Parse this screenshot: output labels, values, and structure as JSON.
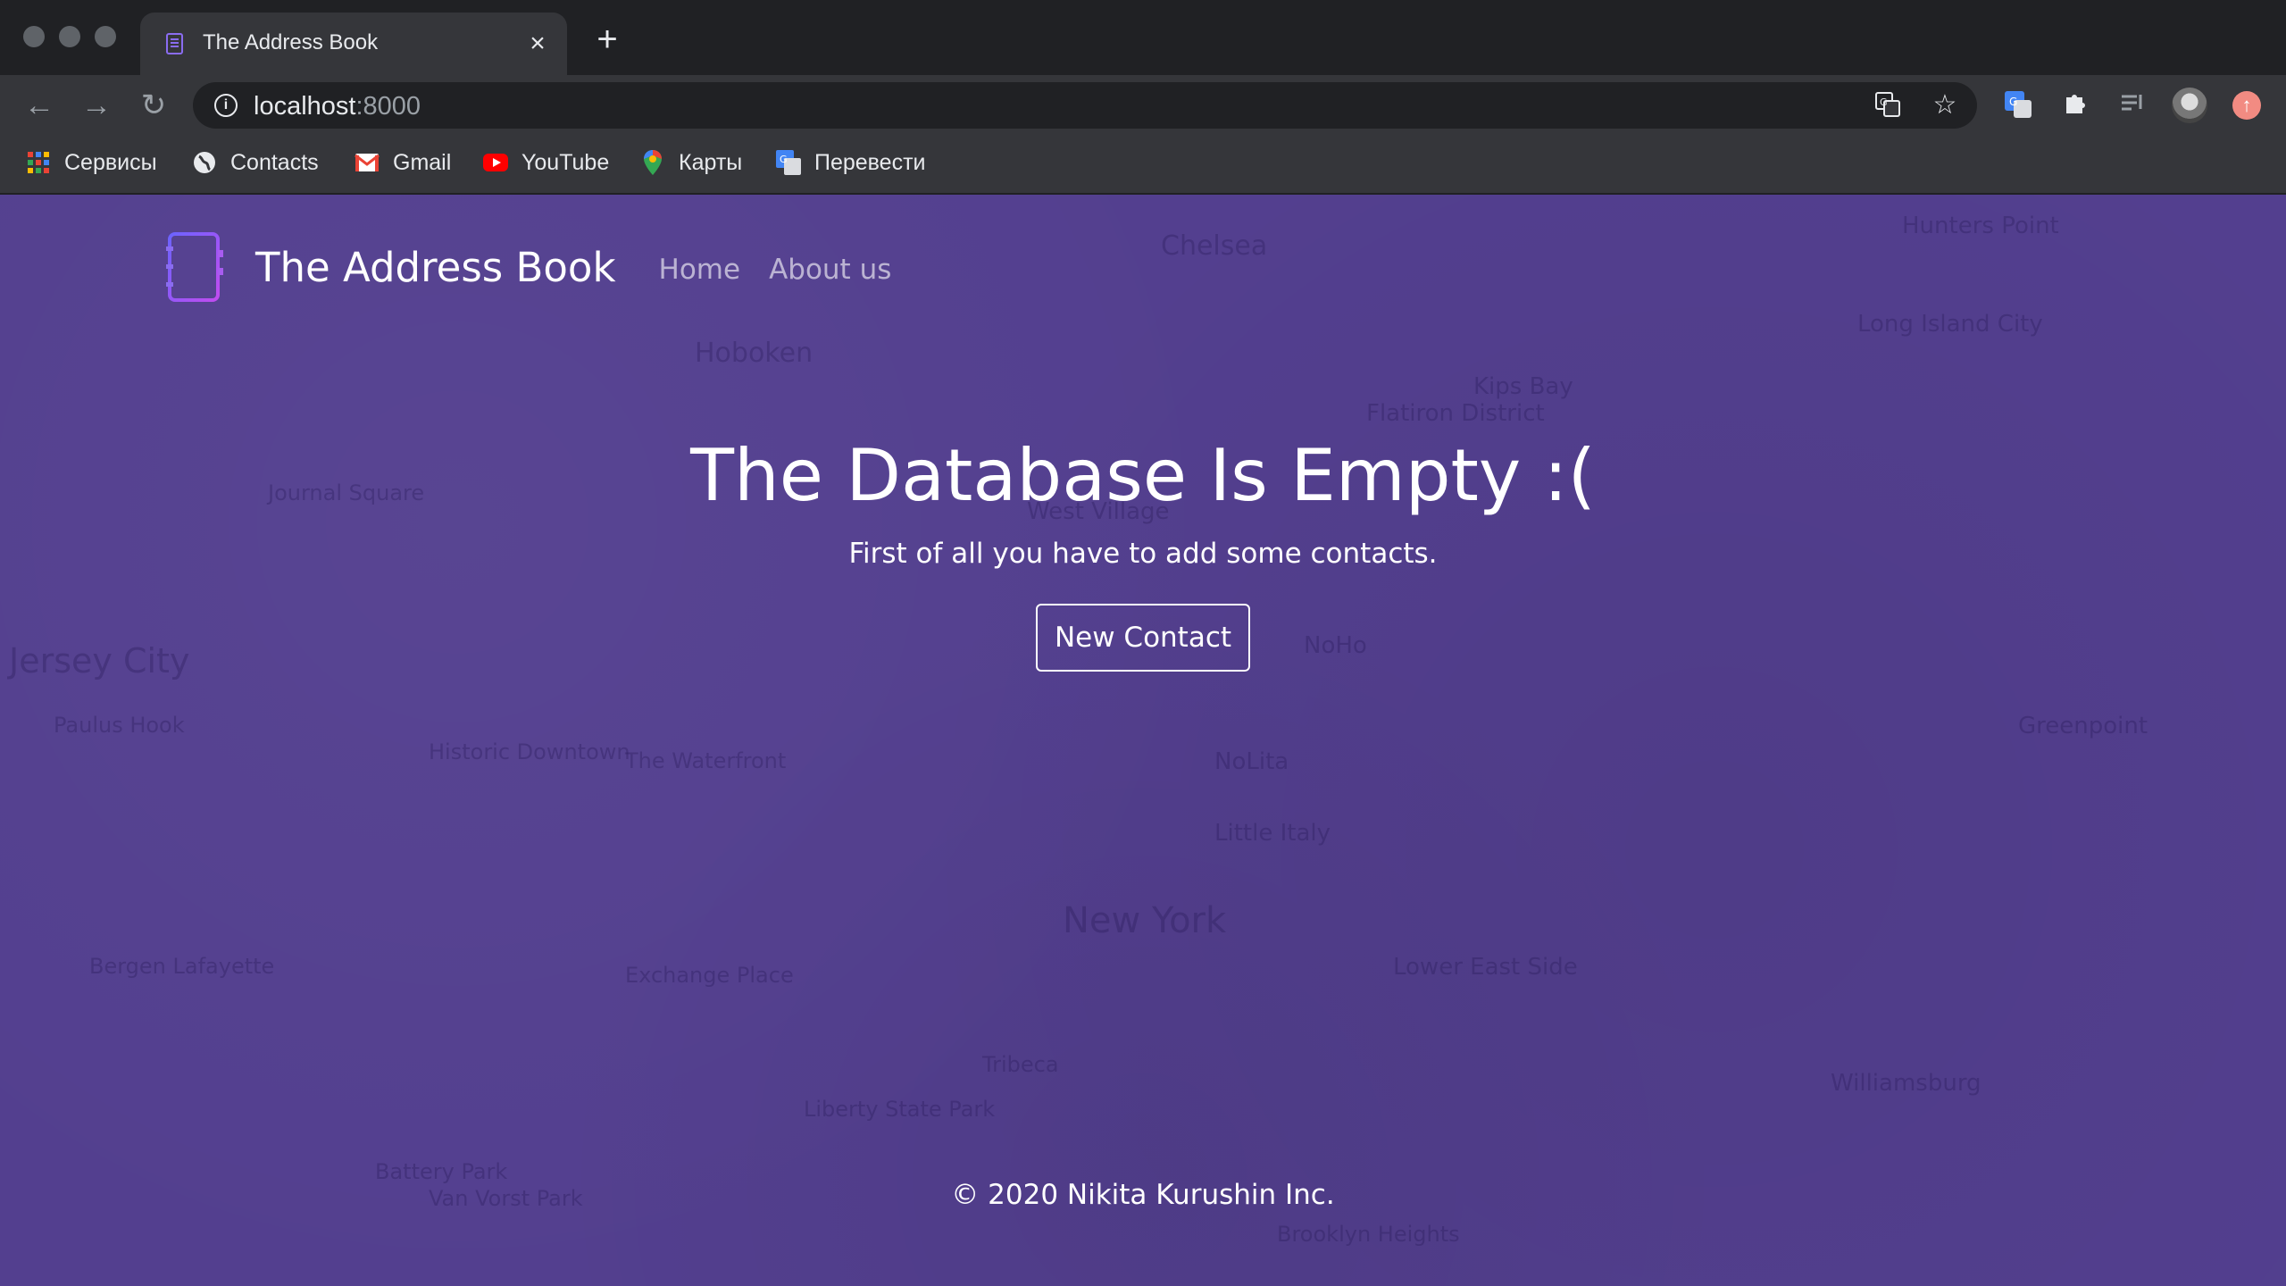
{
  "browser": {
    "tab_title": "The Address Book",
    "url_host": "localhost",
    "url_port": ":8000",
    "bookmarks": [
      {
        "label": "Сервисы",
        "icon": "apps-grid-icon"
      },
      {
        "label": "Contacts",
        "icon": "globe-icon"
      },
      {
        "label": "Gmail",
        "icon": "gmail-icon"
      },
      {
        "label": "YouTube",
        "icon": "youtube-icon"
      },
      {
        "label": "Карты",
        "icon": "maps-pin-icon"
      },
      {
        "label": "Перевести",
        "icon": "translate-icon"
      }
    ]
  },
  "site": {
    "brand": "The Address Book",
    "nav": [
      "Home",
      "About us"
    ]
  },
  "hero": {
    "title": "The Database Is Empty :(",
    "subtitle": "First of all you have to add some contacts.",
    "button": "New Contact"
  },
  "footer": {
    "text": "© 2020 Nikita Kurushin Inc."
  },
  "background_map_labels": [
    "Hoboken",
    "Chelsea",
    "Jersey City",
    "Journal Square",
    "Kips Bay",
    "Flatiron District",
    "West Village",
    "NoHo",
    "NoLita",
    "Little Italy",
    "New York",
    "Lower East Side",
    "Greenpoint",
    "Long Island City",
    "Hunters Point",
    "Williamsburg",
    "Paulus Hook",
    "Liberty State Park",
    "Exchange Place",
    "Brooklyn Heights",
    "Tribeca",
    "Battery Park",
    "The Waterfront",
    "Historic Downtown",
    "Bergen Lafayette",
    "Van Vorst Park"
  ],
  "colors": {
    "page_bg": "#533f8f",
    "chrome_dark": "#202124",
    "chrome": "#35363a",
    "text": "#ffffff"
  }
}
